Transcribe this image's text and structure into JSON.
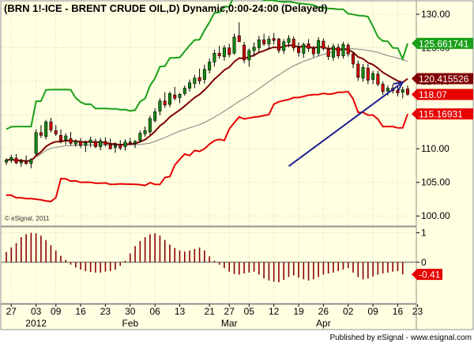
{
  "chart_data": [
    {
      "type": "candlestick",
      "title": "(BRN 1!-ICE - BRENT CRUDE OIL,D) Dynamic,0:00-24:00 (Delayed)",
      "watermark": "© eSignal, 2011",
      "ylim": [
        98.5,
        132
      ],
      "yticks": [
        100.0,
        105.0,
        110.0,
        115.0,
        120.0,
        125.0,
        130.0
      ],
      "ytick_labels": [
        "100.00",
        "105.00",
        "110.00",
        "115.00",
        "120.00",
        "125.00",
        "130.00"
      ],
      "x_day_labels": [
        "27",
        "03",
        "09",
        "16",
        "23",
        "30",
        "06",
        "13",
        "21",
        "27",
        "05",
        "12",
        "19",
        "26",
        "02",
        "09",
        "16",
        "23"
      ],
      "x_month_labels": [
        "2012",
        "Feb",
        "Mar",
        "Apr"
      ],
      "candles": [
        [
          108.0,
          108.6,
          107.6,
          108.3
        ],
        [
          108.3,
          109.1,
          107.9,
          108.7
        ],
        [
          108.6,
          109.2,
          107.7,
          107.9
        ],
        [
          107.9,
          108.5,
          107.3,
          108.1
        ],
        [
          108.2,
          109.0,
          107.6,
          107.8
        ],
        [
          107.8,
          108.6,
          107.1,
          108.4
        ],
        [
          109.3,
          112.9,
          109.0,
          112.4
        ],
        [
          112.4,
          113.5,
          111.6,
          112.0
        ],
        [
          111.8,
          114.3,
          111.4,
          114.0
        ],
        [
          114.0,
          114.6,
          112.4,
          112.8
        ],
        [
          112.7,
          113.5,
          111.9,
          112.2
        ],
        [
          112.0,
          112.9,
          110.8,
          111.2
        ],
        [
          111.3,
          112.3,
          110.6,
          111.9
        ],
        [
          111.5,
          112.5,
          110.5,
          110.8
        ],
        [
          110.7,
          111.4,
          110.3,
          111.1
        ],
        [
          111.1,
          111.6,
          110.1,
          110.5
        ],
        [
          110.5,
          111.2,
          109.5,
          110.9
        ],
        [
          110.9,
          111.8,
          110.2,
          111.3
        ],
        [
          111.1,
          111.5,
          110.1,
          110.3
        ],
        [
          110.3,
          111.6,
          109.8,
          111.2
        ],
        [
          111.1,
          111.7,
          110.3,
          110.6
        ],
        [
          110.6,
          111.5,
          109.9,
          110.0
        ],
        [
          110.2,
          111.0,
          109.4,
          110.5
        ],
        [
          110.5,
          111.3,
          109.8,
          110.1
        ],
        [
          110.3,
          111.4,
          109.7,
          111.0
        ],
        [
          111.0,
          111.6,
          110.6,
          110.8
        ],
        [
          110.8,
          111.3,
          110.1,
          111.1
        ],
        [
          111.2,
          112.7,
          110.9,
          112.3
        ],
        [
          112.2,
          113.3,
          111.8,
          112.7
        ],
        [
          112.5,
          114.9,
          112.1,
          114.5
        ],
        [
          114.2,
          116.0,
          113.9,
          115.5
        ],
        [
          115.6,
          117.5,
          115.0,
          117.1
        ],
        [
          117.1,
          118.4,
          116.1,
          116.5
        ],
        [
          116.6,
          118.5,
          116.2,
          118.2
        ],
        [
          118.0,
          119.2,
          117.2,
          117.5
        ],
        [
          117.6,
          118.3,
          116.8,
          118.1
        ],
        [
          118.2,
          119.4,
          117.9,
          119.0
        ],
        [
          119.0,
          120.3,
          118.5,
          119.8
        ],
        [
          119.7,
          121.0,
          119.0,
          120.5
        ],
        [
          120.6,
          121.9,
          119.6,
          120.1
        ],
        [
          120.3,
          122.5,
          119.7,
          121.8
        ],
        [
          121.7,
          123.4,
          121.2,
          122.9
        ],
        [
          122.9,
          124.7,
          122.2,
          124.2
        ],
        [
          124.2,
          125.3,
          123.4,
          123.8
        ],
        [
          123.7,
          125.4,
          123.1,
          125.0
        ],
        [
          125.0,
          125.6,
          123.6,
          124.0
        ],
        [
          124.2,
          127.1,
          124.0,
          126.6
        ],
        [
          126.8,
          128.8,
          126.0,
          125.9
        ],
        [
          125.4,
          125.9,
          122.7,
          123.2
        ],
        [
          123.2,
          124.9,
          122.2,
          124.6
        ],
        [
          124.6,
          125.8,
          123.7,
          125.1
        ],
        [
          125.0,
          126.8,
          124.3,
          126.2
        ],
        [
          126.2,
          127.1,
          125.3,
          125.6
        ],
        [
          125.6,
          126.8,
          124.7,
          126.3
        ],
        [
          126.4,
          127.2,
          125.5,
          126.1
        ],
        [
          126.3,
          126.5,
          124.2,
          124.6
        ],
        [
          124.6,
          126.3,
          124.1,
          125.9
        ],
        [
          125.8,
          126.9,
          125.1,
          126.4
        ],
        [
          126.3,
          126.7,
          124.5,
          125.0
        ],
        [
          125.0,
          125.8,
          123.7,
          124.3
        ],
        [
          124.2,
          125.8,
          123.5,
          125.5
        ],
        [
          125.6,
          126.3,
          124.4,
          124.9
        ],
        [
          124.9,
          125.3,
          123.6,
          124.1
        ],
        [
          124.2,
          126.6,
          123.8,
          126.1
        ],
        [
          126.0,
          126.4,
          124.6,
          124.9
        ],
        [
          124.8,
          125.4,
          123.2,
          123.7
        ],
        [
          123.6,
          125.6,
          123.1,
          125.2
        ],
        [
          125.1,
          125.6,
          123.4,
          123.8
        ],
        [
          123.8,
          125.9,
          123.4,
          125.5
        ],
        [
          125.4,
          125.7,
          123.7,
          124.1
        ],
        [
          124.1,
          124.4,
          122.0,
          122.6
        ],
        [
          122.6,
          123.1,
          120.1,
          120.6
        ],
        [
          120.5,
          122.6,
          120.0,
          122.1
        ],
        [
          122.0,
          122.6,
          119.6,
          120.2
        ],
        [
          120.3,
          121.6,
          119.6,
          121.2
        ],
        [
          121.1,
          121.6,
          119.3,
          119.6
        ],
        [
          119.6,
          120.0,
          118.0,
          118.5
        ],
        [
          118.6,
          119.4,
          117.9,
          119.0
        ],
        [
          119.0,
          119.6,
          118.2,
          118.6
        ],
        [
          118.7,
          119.4,
          117.8,
          118.3
        ],
        [
          118.4,
          119.2,
          117.5,
          118.8
        ],
        [
          118.9,
          119.4,
          117.9,
          118.1
        ]
      ],
      "bands": {
        "upper_color": "#1aa01a",
        "lower_color": "#e60000",
        "ma_dark_color": "#800000",
        "ma_gray_color": "#808080"
      },
      "last_values": [
        {
          "label": "125.661741",
          "value": 125.661741,
          "color": "#1aa01a"
        },
        {
          "label": "120.415526",
          "value": 120.415526,
          "color": "#800000"
        },
        {
          "label": "118.07",
          "value": 118.07,
          "color": "#e60000"
        },
        {
          "label": "115.16931",
          "value": 115.16931,
          "color": "#e60000"
        }
      ],
      "arrow": {
        "from": {
          "x_index": 57,
          "y": 107.4
        },
        "to": {
          "x_index": 80,
          "y": 119.9
        },
        "color": "#1f1f8f"
      }
    },
    {
      "type": "bar",
      "name": "oscillator",
      "ylim": [
        -1.4,
        1.2
      ],
      "yticks": [
        1.0,
        0.0
      ],
      "ytick_labels": [
        "1",
        "0"
      ],
      "last_value": {
        "label": "-0.41",
        "value": -0.41,
        "color": "#e60000"
      },
      "values": [
        0.35,
        0.5,
        0.65,
        0.85,
        0.95,
        1.0,
        0.98,
        0.9,
        0.75,
        0.58,
        0.4,
        0.22,
        0.08,
        -0.08,
        -0.18,
        -0.25,
        -0.3,
        -0.33,
        -0.35,
        -0.35,
        -0.32,
        -0.3,
        -0.25,
        -0.12,
        0.05,
        0.3,
        0.55,
        0.72,
        0.85,
        0.95,
        0.98,
        0.9,
        0.75,
        0.6,
        0.48,
        0.4,
        0.36,
        0.4,
        0.45,
        0.5,
        0.4,
        0.2,
        0.05,
        -0.08,
        -0.2,
        -0.32,
        -0.4,
        -0.42,
        -0.38,
        -0.35,
        -0.32,
        -0.42,
        -0.55,
        -0.62,
        -0.66,
        -0.68,
        -0.6,
        -0.5,
        -0.45,
        -0.52,
        -0.58,
        -0.62,
        -0.58,
        -0.5,
        -0.42,
        -0.38,
        -0.35,
        -0.3,
        -0.25,
        -0.2,
        -0.35,
        -0.5,
        -0.58,
        -0.55,
        -0.48,
        -0.42,
        -0.38,
        -0.35,
        -0.32,
        -0.3,
        -0.41
      ]
    }
  ],
  "footer": {
    "text": "Published by eSignal - www.esignal.com"
  }
}
